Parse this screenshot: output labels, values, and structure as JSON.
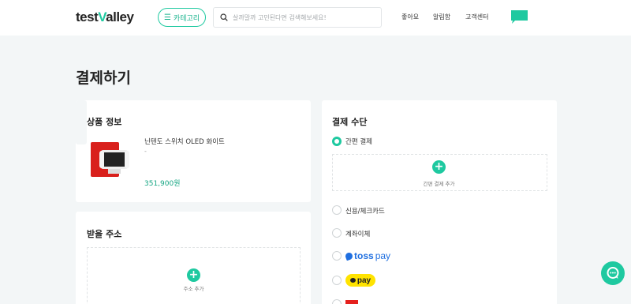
{
  "header": {
    "logo_test": "test",
    "logo_v": "V",
    "logo_alley": "alley",
    "category_button": "카테고리",
    "search_placeholder": "살까말까 고민된다면 검색해보세요!",
    "nav": [
      "좋아요",
      "알림함",
      "고객센터"
    ]
  },
  "page": {
    "title": "결제하기"
  },
  "product_section": {
    "title": "상품 정보",
    "item_name": "닌텐도 스위치 OLED 화이트",
    "item_option": "-",
    "item_price": "351,900원"
  },
  "address_section": {
    "title": "받을 주소",
    "add_label": "주소 추가"
  },
  "payment_section": {
    "title": "결제 수단",
    "options": [
      {
        "label": "간편 결제",
        "selected": true
      },
      {
        "label": "신용/체크카드",
        "selected": false
      },
      {
        "label": "계좌이체",
        "selected": false
      }
    ],
    "easy_add_label": "간편 결제 추가",
    "toss_text": "toss",
    "toss_pay_text": "pay",
    "kakao_text": "pay"
  },
  "colors": {
    "accent": "#1ec9a0",
    "price": "#16a683",
    "toss_blue": "#1f6fe0",
    "kakao_yellow": "#ffe300"
  },
  "icons": [
    "menu-icon",
    "search-icon",
    "chat-icon",
    "plus-icon",
    "toss-logo-icon",
    "kakao-bubble-icon"
  ]
}
